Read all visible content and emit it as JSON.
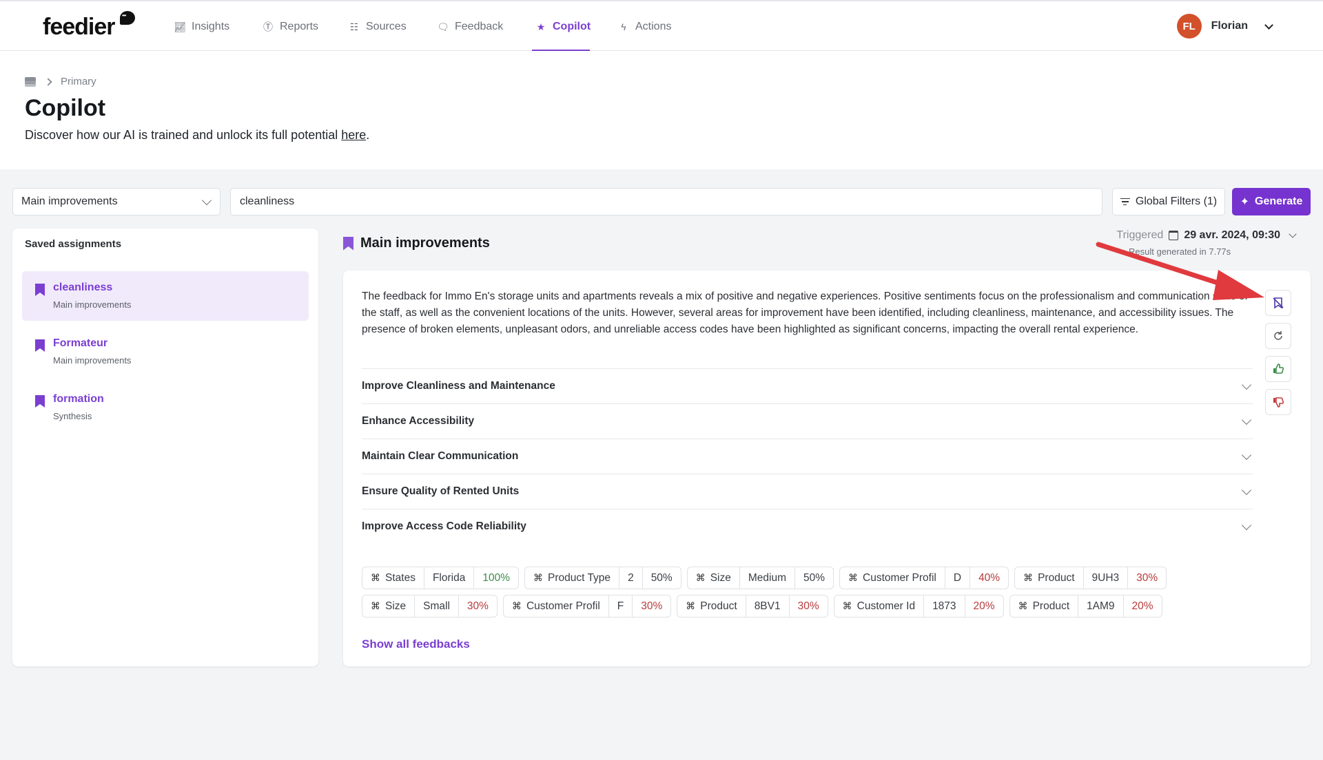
{
  "nav": {
    "logo": "feedier",
    "items": [
      {
        "label": "Insights",
        "icon": "chart-icon"
      },
      {
        "label": "Reports",
        "icon": "reports-icon"
      },
      {
        "label": "Sources",
        "icon": "sources-icon"
      },
      {
        "label": "Feedback",
        "icon": "feedback-icon"
      },
      {
        "label": "Copilot",
        "icon": "sparkle-icon",
        "active": true
      },
      {
        "label": "Actions",
        "icon": "bolt-icon"
      }
    ],
    "user": {
      "initials": "FL",
      "name": "Florian"
    }
  },
  "header": {
    "breadcrumb": "Primary",
    "title": "Copilot",
    "subtitle_prefix": "Discover how our AI is trained and unlock its full potential ",
    "subtitle_link": "here",
    "subtitle_suffix": "."
  },
  "controls": {
    "assignment_type": "Main improvements",
    "query": "cleanliness",
    "global_filters_label": "Global Filters (1)",
    "generate_label": "Generate"
  },
  "saved": {
    "title": "Saved assignments",
    "items": [
      {
        "title": "cleanliness",
        "type": "Main improvements",
        "active": true
      },
      {
        "title": "Formateur",
        "type": "Main improvements"
      },
      {
        "title": "formation",
        "type": "Synthesis"
      }
    ]
  },
  "result": {
    "title": "Main improvements",
    "triggered_label": "Triggered",
    "triggered_date": "29 avr. 2024, 09:30",
    "generated_in": "Result generated in 7.77s",
    "summary": "The feedback for Immo En's storage units and apartments reveals a mix of positive and negative experiences. Positive sentiments focus on the professionalism and communication skills of the staff, as well as the convenient locations of the units. However, several areas for improvement have been identified, including cleanliness, maintenance, and accessibility issues. The presence of broken elements, unpleasant odors, and unreliable access codes have been highlighted as significant concerns, impacting the overall rental experience.",
    "improvements": [
      "Improve Cleanliness and Maintenance",
      "Enhance Accessibility",
      "Maintain Clear Communication",
      "Ensure Quality of Rented Units",
      "Improve Access Code Reliability"
    ],
    "tag_rows": [
      [
        {
          "field": "States",
          "value": "Florida",
          "pct": "100%",
          "tone": "green"
        },
        {
          "field": "Product Type",
          "value": "2",
          "pct": "50%",
          "tone": "neutral"
        },
        {
          "field": "Size",
          "value": "Medium",
          "pct": "50%",
          "tone": "neutral"
        },
        {
          "field": "Customer Profil",
          "value": "D",
          "pct": "40%",
          "tone": "red"
        },
        {
          "field": "Product",
          "value": "9UH3",
          "pct": "30%",
          "tone": "red"
        }
      ],
      [
        {
          "field": "Size",
          "value": "Small",
          "pct": "30%",
          "tone": "red"
        },
        {
          "field": "Customer Profil",
          "value": "F",
          "pct": "30%",
          "tone": "red"
        },
        {
          "field": "Product",
          "value": "8BV1",
          "pct": "30%",
          "tone": "red"
        },
        {
          "field": "Customer Id",
          "value": "1873",
          "pct": "20%",
          "tone": "red"
        },
        {
          "field": "Product",
          "value": "1AM9",
          "pct": "20%",
          "tone": "red"
        }
      ]
    ],
    "show_all_label": "Show all feedbacks",
    "side_actions": [
      "unsave-bookmark",
      "regenerate",
      "thumbs-up",
      "thumbs-down"
    ]
  },
  "colors": {
    "accent": "#7633cf",
    "positive": "#3b8c4a",
    "negative": "#b83a3a",
    "avatar": "#d2502a",
    "annotation_arrow": "#e03a3e"
  }
}
